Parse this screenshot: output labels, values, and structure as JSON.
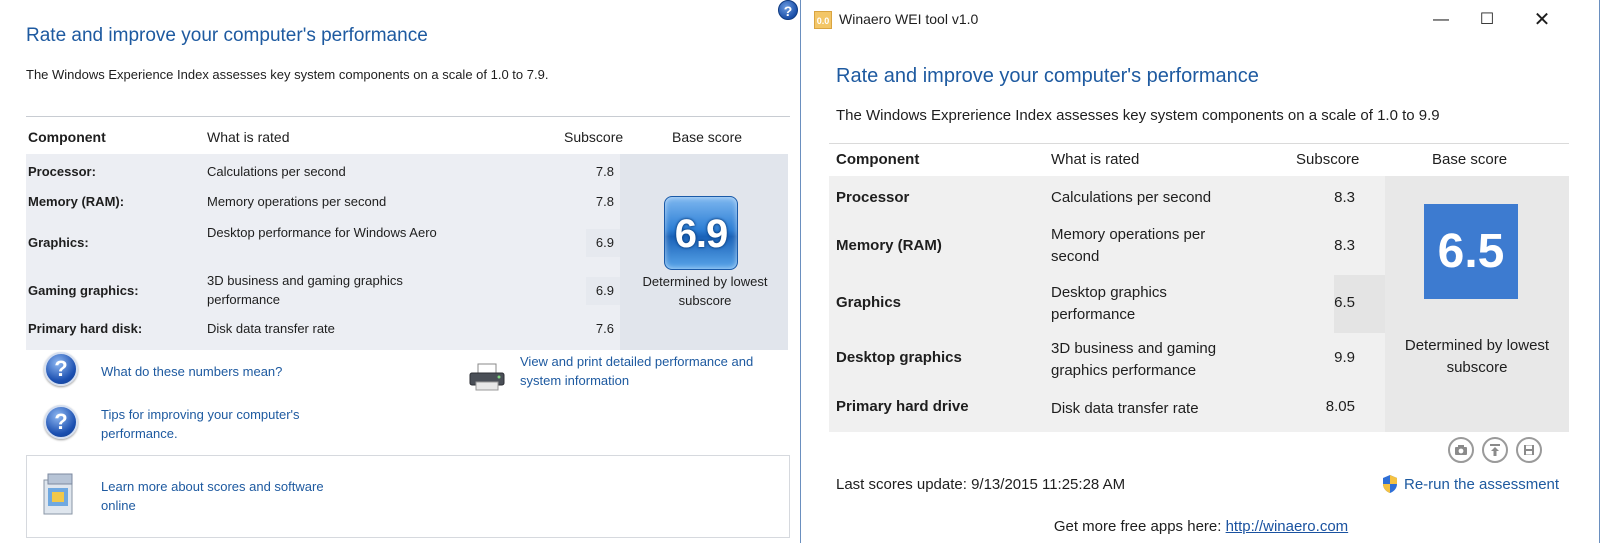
{
  "left": {
    "title": "Rate and improve your computer's performance",
    "description": "The Windows Experience Index assesses key system components on a scale of 1.0 to 7.9.",
    "headers": {
      "component": "Component",
      "what": "What is rated",
      "subscore": "Subscore",
      "base": "Base score"
    },
    "rows": [
      {
        "component": "Processor:",
        "what": "Calculations per second",
        "subscore": "7.8"
      },
      {
        "component": "Memory (RAM):",
        "what": "Memory operations per second",
        "subscore": "7.8"
      },
      {
        "component": "Graphics:",
        "what": "Desktop performance for Windows Aero",
        "subscore": "6.9"
      },
      {
        "component": "Gaming graphics:",
        "what": "3D business and gaming graphics performance",
        "subscore": "6.9"
      },
      {
        "component": "Primary hard disk:",
        "what": "Disk data transfer rate",
        "subscore": "7.6"
      }
    ],
    "base_score": "6.9",
    "base_note": "Determined by lowest subscore",
    "links": {
      "what_mean": "What do these numbers mean?",
      "tips": "Tips for improving your computer's performance.",
      "view_print": "View and print detailed performance and system information",
      "learn_more": "Learn more about scores and software online"
    }
  },
  "window": {
    "title": "Winaero WEI tool v1.0",
    "app_icon_text": "0.0",
    "heading": "Rate and improve your computer's performance",
    "description": "The Windows Exprerience Index assesses key system components on a scale of 1.0 to 9.9",
    "headers": {
      "component": "Component",
      "what": "What is rated",
      "subscore": "Subscore",
      "base": "Base score"
    },
    "rows": [
      {
        "component": "Processor",
        "what": "Calculations per second",
        "subscore": "8.3"
      },
      {
        "component": "Memory (RAM)",
        "what": "Memory operations per second",
        "subscore": "8.3"
      },
      {
        "component": "Graphics",
        "what": "Desktop graphics performance",
        "subscore": "6.5"
      },
      {
        "component": "Desktop graphics",
        "what": "3D business and gaming graphics performance",
        "subscore": "9.9"
      },
      {
        "component": "Primary hard drive",
        "what": "Disk data transfer rate",
        "subscore": "8.05"
      }
    ],
    "base_score": "6.5",
    "base_note": "Determined by lowest subscore",
    "last_update": "Last scores update: 9/13/2015 11:25:28 AM",
    "rerun": "Re-run the assessment",
    "footer_prefix": "Get more free apps here:",
    "footer_link": "http://winaero.com",
    "icons": [
      "camera-icon",
      "upload-icon",
      "save-icon"
    ],
    "accent": "#3d7bd0"
  }
}
